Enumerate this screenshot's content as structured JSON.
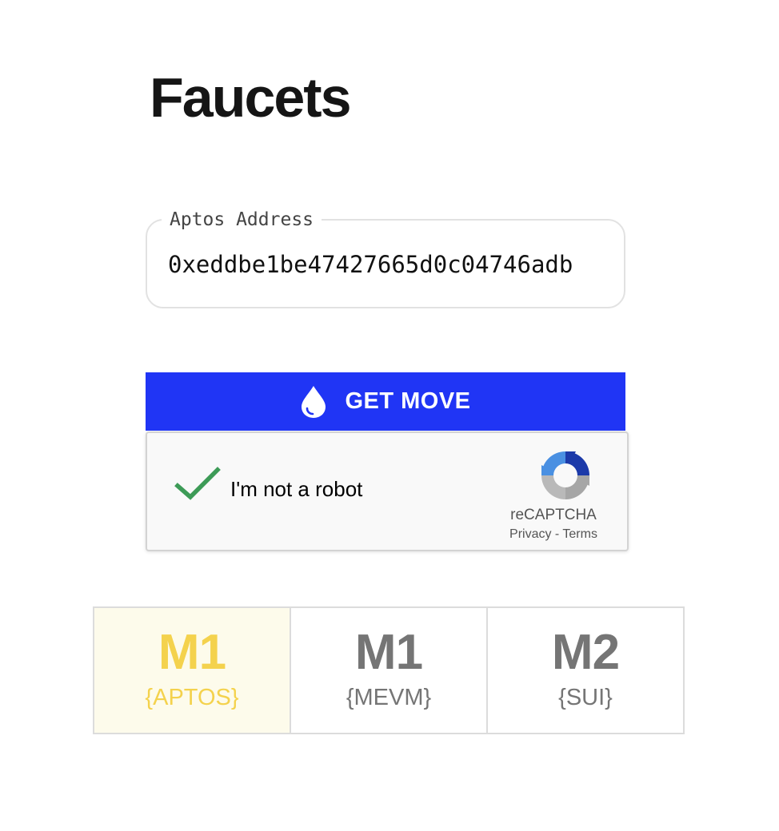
{
  "page": {
    "title": "Faucets"
  },
  "address_field": {
    "legend": "Aptos Address",
    "value": "0xeddbe1be47427665d0c04746adb"
  },
  "get_move_button": {
    "label": "GET MOVE",
    "icon": "water-drop-icon",
    "color": "#2035f5"
  },
  "recaptcha": {
    "label": "I'm not a robot",
    "checked": true,
    "brand": "reCAPTCHA",
    "privacy_label": "Privacy",
    "separator": "-",
    "terms_label": "Terms"
  },
  "network_tabs": [
    {
      "version": "M1",
      "chain": "{APTOS}",
      "active": true
    },
    {
      "version": "M1",
      "chain": "{MEVM}",
      "active": false
    },
    {
      "version": "M2",
      "chain": "{SUI}",
      "active": false
    }
  ],
  "colors": {
    "accent_blue": "#2035f5",
    "active_tab_text": "#f4d24d",
    "active_tab_bg": "#fdfbeb",
    "inactive_tab_text": "#757575",
    "check_green": "#3d9b57"
  }
}
